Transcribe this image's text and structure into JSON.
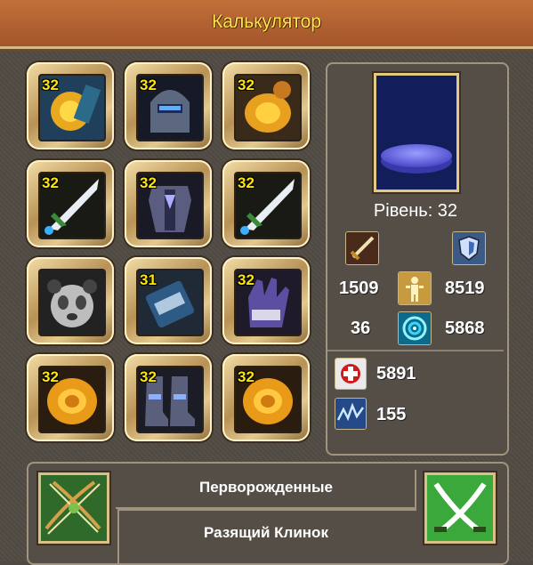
{
  "header": {
    "title": "Калькулятор"
  },
  "slots": [
    {
      "level": "32",
      "icon": "gold-amulet-icon"
    },
    {
      "level": "32",
      "icon": "helmet-icon"
    },
    {
      "level": "32",
      "icon": "gold-pauldron-icon"
    },
    {
      "level": "32",
      "icon": "sword-icon"
    },
    {
      "level": "32",
      "icon": "armor-icon"
    },
    {
      "level": "32",
      "icon": "sword-icon"
    },
    {
      "level": "",
      "icon": "panda-icon"
    },
    {
      "level": "31",
      "icon": "bracer-icon"
    },
    {
      "level": "32",
      "icon": "gloves-icon"
    },
    {
      "level": "32",
      "icon": "gold-ring-icon"
    },
    {
      "level": "32",
      "icon": "boots-icon"
    },
    {
      "level": "32",
      "icon": "gold-ring-icon"
    }
  ],
  "character": {
    "level_label": "Рівень: 32",
    "attack": "1509",
    "defense": "8519",
    "stat_three": "36",
    "stat_four": "5868",
    "health": "5891",
    "energy": "155"
  },
  "footer": {
    "race": "Перворожденные",
    "class_name": "Разящий Клинок",
    "race_icon": "crossed-bows-icon",
    "class_icon": "crossed-blades-icon"
  },
  "colors": {
    "header_bg": "#b5612f",
    "title": "#ffe74a",
    "level_badge": "#ffe600",
    "panel_bg": "#544e47"
  }
}
